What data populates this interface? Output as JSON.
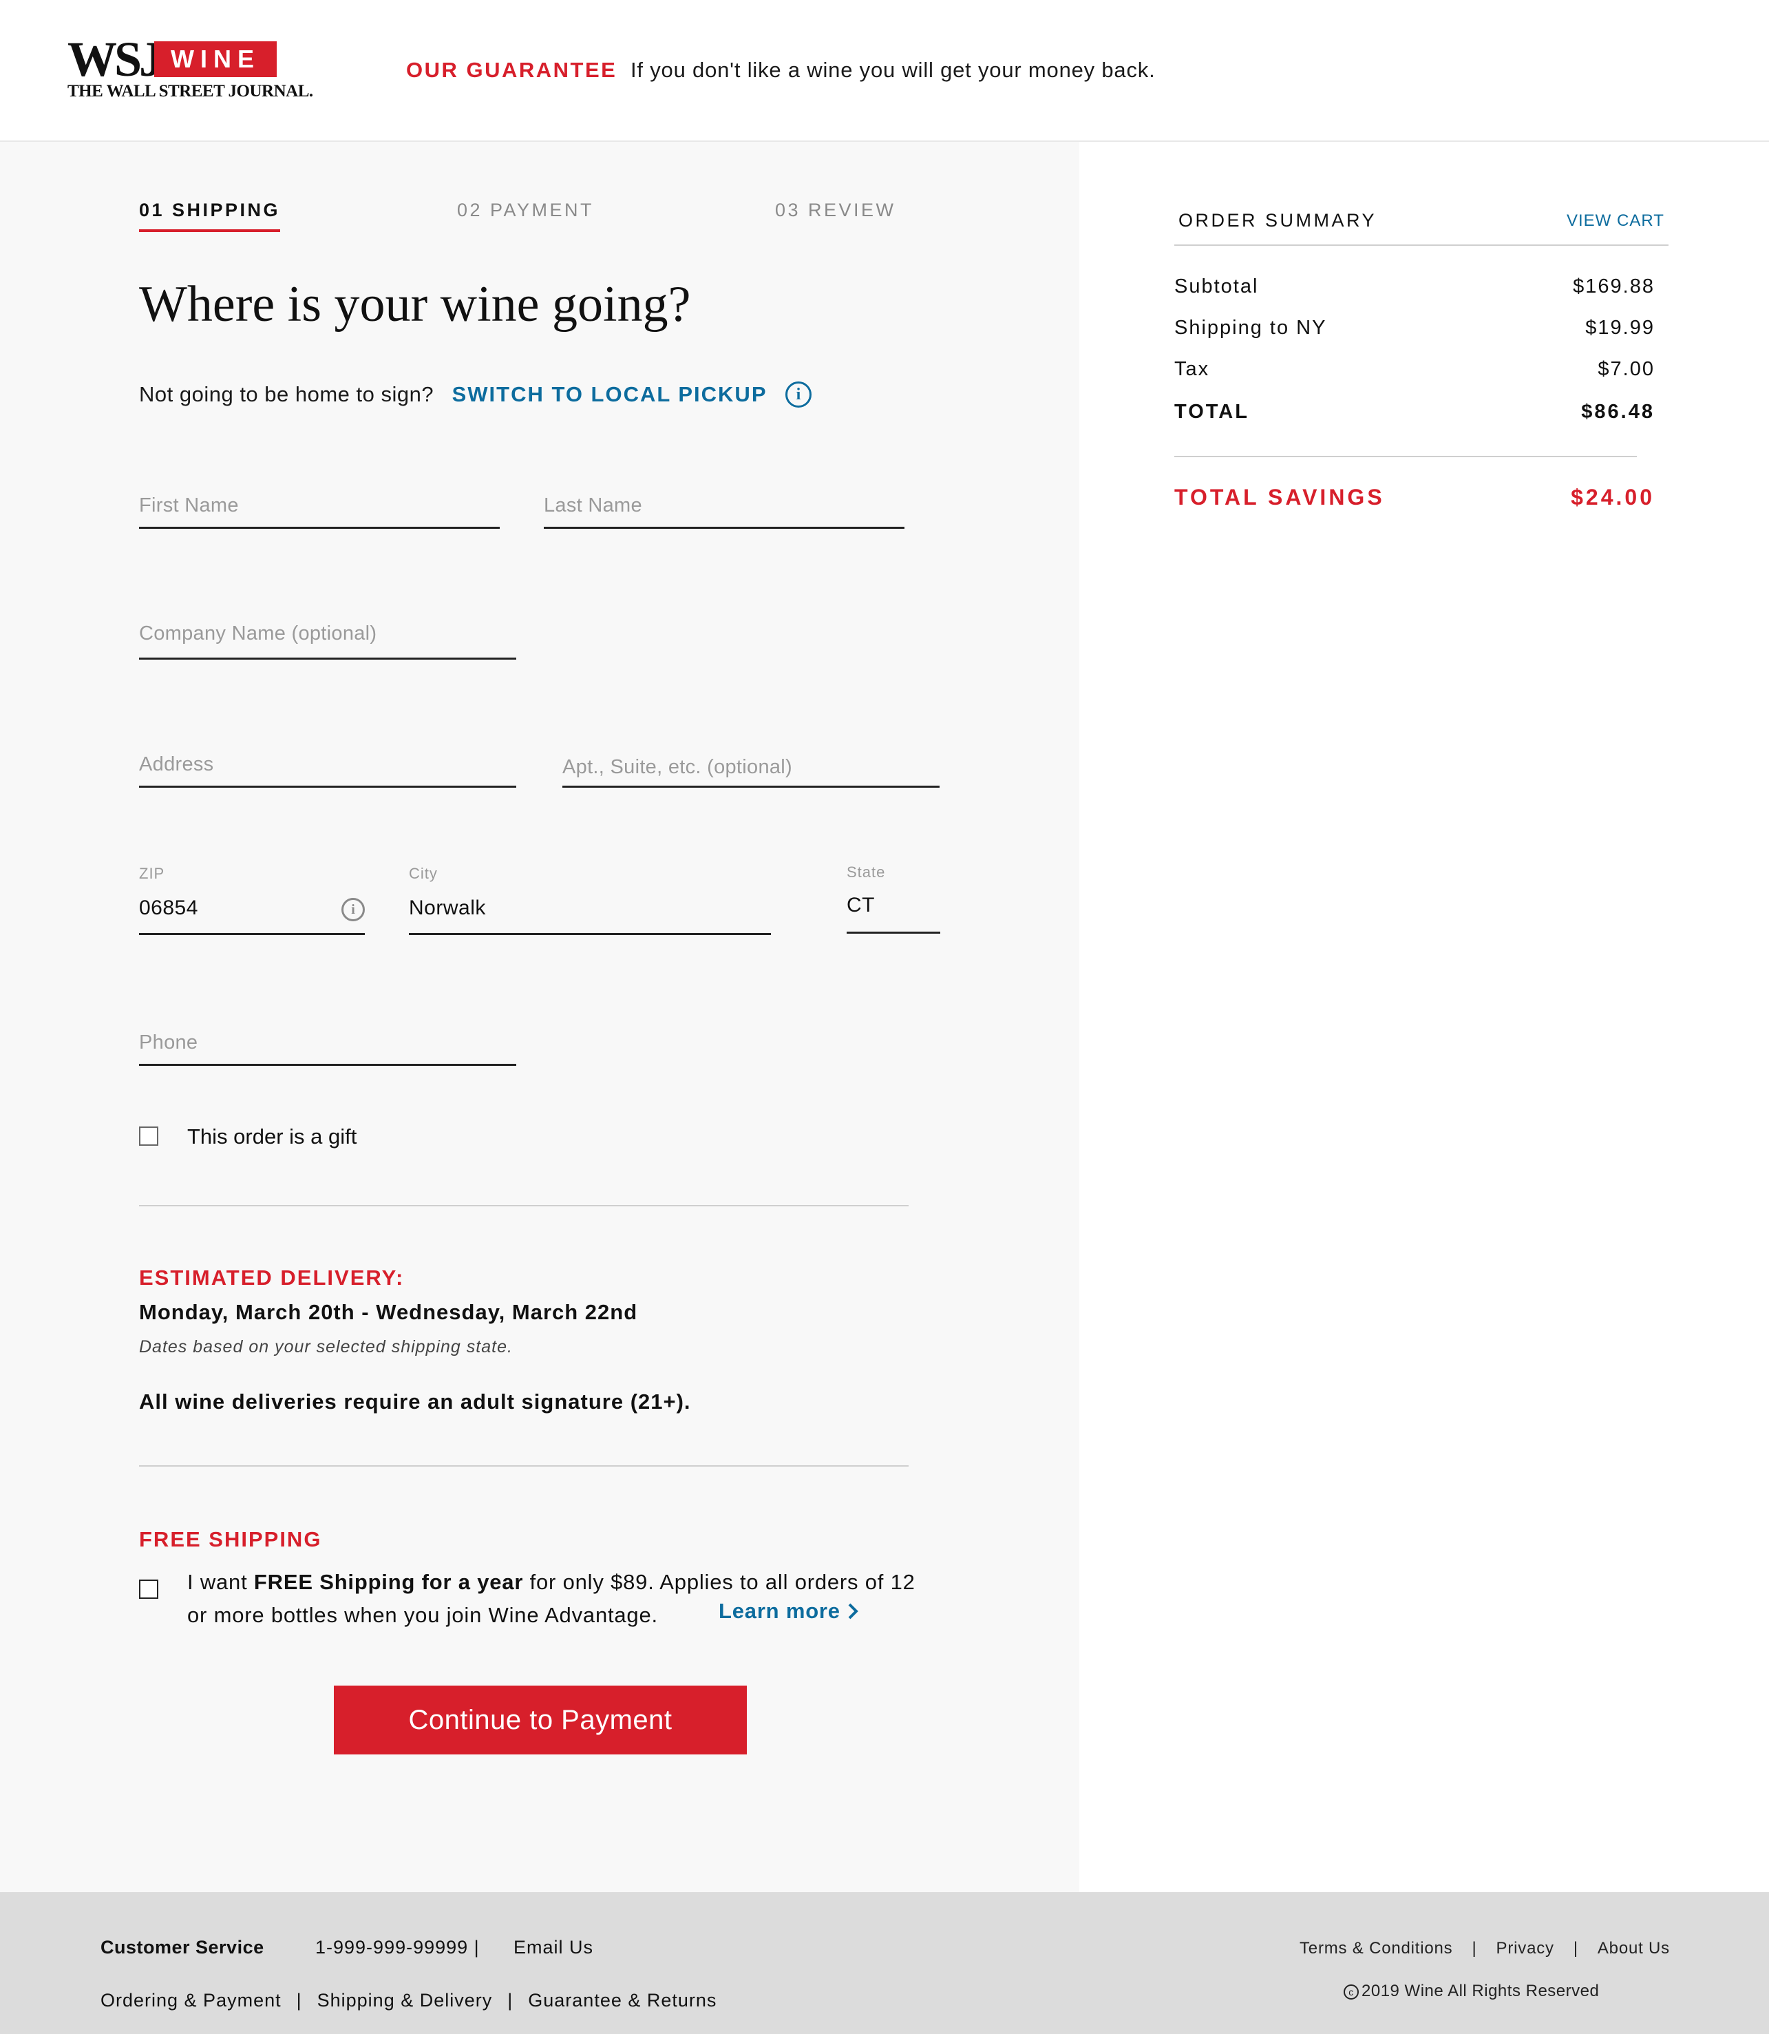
{
  "header": {
    "logo_wsj": "WSJ",
    "logo_wine": "WINE",
    "logo_journal": "THE WALL STREET JOURNAL.",
    "guarantee_label": "OUR GUARANTEE",
    "guarantee_text": "If you don't like a wine you will get your money back."
  },
  "steps": [
    {
      "label": "01 SHIPPING",
      "active": true
    },
    {
      "label": "02 PAYMENT",
      "active": false
    },
    {
      "label": "03 REVIEW",
      "active": false
    }
  ],
  "form": {
    "title": "Where is your wine going?",
    "pickup_question": "Not going to be home to sign?",
    "pickup_link": "SWITCH TO LOCAL PICKUP",
    "first_name_placeholder": "First Name",
    "last_name_placeholder": "Last Name",
    "company_placeholder": "Company Name  (optional)",
    "address_placeholder": "Address",
    "apt_placeholder": "Apt., Suite, etc. (optional)",
    "zip_label": "ZIP",
    "zip_value": "06854",
    "city_label": "City",
    "city_value": "Norwalk",
    "state_label": "State",
    "state_value": "CT",
    "phone_placeholder": "Phone",
    "gift_label": "This order is a gift",
    "gift_checked": false
  },
  "delivery": {
    "label": "ESTIMATED DELIVERY:",
    "dates": "Monday, March 20th - Wednesday, March 22nd",
    "note": "Dates based on your selected shipping state.",
    "signature": "All wine deliveries require an adult signature (21+)."
  },
  "free_shipping": {
    "label": "FREE SHIPPING",
    "text_pre": "I want ",
    "text_bold": "FREE Shipping for a year",
    "text_post": " for only $89.  Applies to all orders of 12 or more bottles when you join Wine Advantage.",
    "learn_more": "Learn more",
    "checked": false
  },
  "continue_button": "Continue to Payment",
  "summary": {
    "title": "ORDER SUMMARY",
    "view_cart": "VIEW CART",
    "rows": [
      {
        "label": "Subtotal",
        "amount": "$169.88"
      },
      {
        "label": "Shipping to NY",
        "amount": "$19.99"
      },
      {
        "label": "Tax",
        "amount": "$7.00"
      },
      {
        "label": "TOTAL",
        "amount": "$86.48"
      }
    ],
    "savings_label": "TOTAL SAVINGS",
    "savings_amount": "$24.00"
  },
  "footer": {
    "customer_service": "Customer Service",
    "phone": "1-999-999-99999 |",
    "email": "Email Us",
    "links": [
      "Ordering & Payment",
      "Shipping & Delivery",
      "Guarantee & Returns"
    ],
    "right_links": [
      "Terms & Conditions",
      "Privacy",
      "About Us"
    ],
    "copyright_symbol": "©",
    "copyright": "2019 Wine All Rights Reserved",
    "separator": "|"
  },
  "icons": {
    "info": "info-icon",
    "chevron": "chevron-right-icon"
  },
  "colors": {
    "brand_red": "#d71f2b",
    "link_blue": "#0d6c9e",
    "panel_bg": "#f8f8f8",
    "footer_bg": "#dcdcdc"
  }
}
